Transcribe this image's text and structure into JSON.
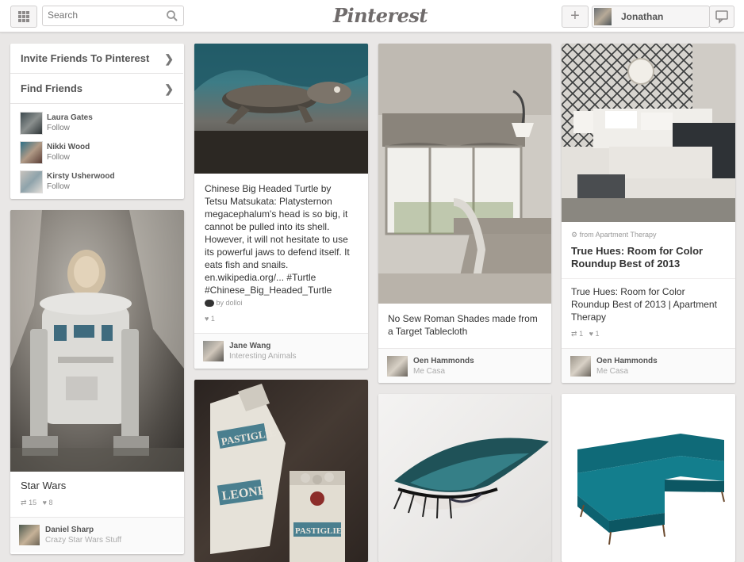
{
  "header": {
    "search_placeholder": "Search",
    "logo": "Pinterest",
    "add_label": "+",
    "user_name": "Jonathan"
  },
  "sidebar": {
    "invite_label": "Invite Friends To Pinterest",
    "find_label": "Find Friends",
    "friends": [
      {
        "name": "Laura Gates",
        "action": "Follow"
      },
      {
        "name": "Nikki Wood",
        "action": "Follow"
      },
      {
        "name": "Kirsty Usherwood",
        "action": "Follow"
      }
    ]
  },
  "pins": {
    "starwars": {
      "title": "Star Wars",
      "repins": "15",
      "likes": "8",
      "pinner": "Daniel Sharp",
      "board": "Crazy Star Wars Stuff"
    },
    "turtle": {
      "desc_line1": "Chinese Big Headed Turtle by",
      "desc_line2": "Tetsu Matsukata: Platysternon",
      "desc_line3": "megacephalum's head is so big, it",
      "desc_line4": "cannot be pulled into its shell.",
      "desc_line5": "However, it will not hesitate to use",
      "desc_line6": "its powerful jaws to defend itself. It",
      "desc_line7": "eats fish and snails.",
      "desc_line8": "en.wikipedia.org/... #Turtle",
      "desc_line9": "#Chinese_Big_Headed_Turtle",
      "via": "by dolloi",
      "likes": "1",
      "pinner": "Jane Wang",
      "board": "Interesting Animals"
    },
    "shades": {
      "desc_line1": "No Sew Roman Shades made from",
      "desc_line2": "a Target Tablecloth",
      "pinner": "Oen Hammonds",
      "board": "Me Casa"
    },
    "bedroom": {
      "source": "from Apartment Therapy",
      "title_line1": "True Hues: Room for Color",
      "title_line2": "Roundup Best of 2013",
      "desc_line1": "True Hues: Room for Color",
      "desc_line2": "Roundup Best of 2013 | Apartment",
      "desc_line3": "Therapy",
      "repins": "1",
      "likes": "1",
      "pinner": "Oen Hammonds",
      "board": "Me Casa"
    },
    "pastiglie": {
      "label1": "PASTIGLIE",
      "label2": "LEONE",
      "label3": "PASTIGLIE"
    }
  }
}
